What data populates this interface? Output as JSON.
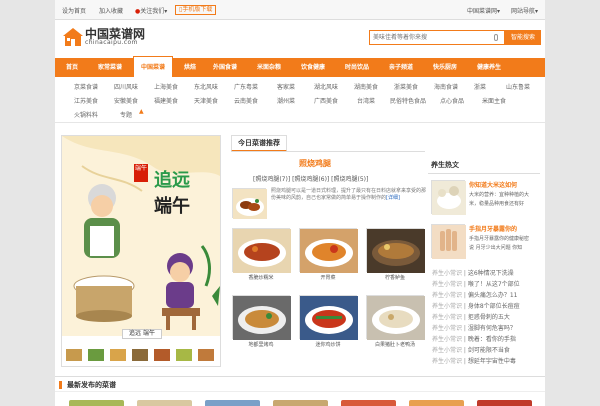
{
  "topbar": {
    "set_home": "设为首页",
    "add_fav": "加入收藏",
    "follow": "关注我们",
    "mobile": "手机版下载",
    "site_name": "中国菜谱网",
    "site_nav": "网站导航"
  },
  "header": {
    "logo_cn": "中国菜谱网",
    "logo_en": "chinacaipu.com",
    "search_placeholder": "美味佳肴等着你来搜",
    "search_button": "智能搜索"
  },
  "nav": {
    "items": [
      "首页",
      "家常菜谱",
      "中国菜谱",
      "烘焙",
      "外国食谱",
      "米面杂粮",
      "饮食健康",
      "时尚饮品",
      "亲子频道",
      "快乐厨房",
      "健康养生"
    ],
    "active_index": 2
  },
  "subnav": {
    "row1": [
      "京菜食谱",
      "四川风味",
      "上海美食",
      "东北风味",
      "广东粤菜",
      "客家菜",
      "湖北风味",
      "湖南美食",
      "浙菜美食",
      "海南食谱",
      "浙菜",
      "山东鲁菜"
    ],
    "row2": [
      "江苏美食",
      "安徽美食",
      "福建美食",
      "天津美食",
      "云南美食",
      "潮州菜",
      "广西美食",
      "台湾菜",
      "民俗特色食品",
      "点心食品",
      "米面主食"
    ],
    "row3": [
      "火锅料料",
      "专题"
    ]
  },
  "poster": {
    "seal": "端午",
    "line1": "追远",
    "line2": "端午",
    "caption": "追远 端午"
  },
  "recommend": {
    "tab": "今日菜谱推荐",
    "title": "照烧鸡腿",
    "links": "[照烧鸡腿(7)]  [照烧鸡腿(6)]  [照烧鸡腿(5)]",
    "desc": "照烧鸡腿可以是一道日式料理，提升了最只有在日料店就拿来享受的那份美味的风韵，自己也家常做的简单易于操作制作的",
    "more": "[详细]",
    "grid": [
      {
        "label": "香脆炒糯米"
      },
      {
        "label": "开胃菜"
      },
      {
        "label": "柠香鲈鱼"
      },
      {
        "label": "地都里烤鸡"
      },
      {
        "label": "迷你鸡炒饼"
      },
      {
        "label": "白果猪肚卜老鸭汤"
      }
    ]
  },
  "hot": {
    "tab": "养生热文",
    "items": [
      {
        "title": "你知道大米这如何",
        "desc1": "大米的营养：宜种种植的大",
        "desc2": "米，稳量品种用食还有好"
      },
      {
        "title": "手指月牙暴露你的",
        "desc1": "手指月牙暴露你的健康秘密",
        "desc2": "说 月牙少出大问题 你知"
      }
    ],
    "tips": [
      {
        "tag": "养生小常识",
        "text": "这6种情况下洗澡"
      },
      {
        "tag": "养生小常识",
        "text": "喉了！从这7个部位"
      },
      {
        "tag": "养生小常识",
        "text": "偏头痛怎么办？11"
      },
      {
        "tag": "养生小常识",
        "text": "身体8个部位长痘痘"
      },
      {
        "tag": "养生小常识",
        "text": "拒惑骨刺的五大"
      },
      {
        "tag": "养生小常识",
        "text": "湿脚有何危害吗？"
      },
      {
        "tag": "养生小常识",
        "text": "晚着：看你的手指"
      },
      {
        "tag": "养生小常识",
        "text": "剑可能限不当食"
      },
      {
        "tag": "养生小常识",
        "text": "想延年宇宙性中毒"
      }
    ]
  },
  "latest": {
    "title": "最新发布的菜谱"
  },
  "colors": {
    "accent": "#f27b1a"
  }
}
